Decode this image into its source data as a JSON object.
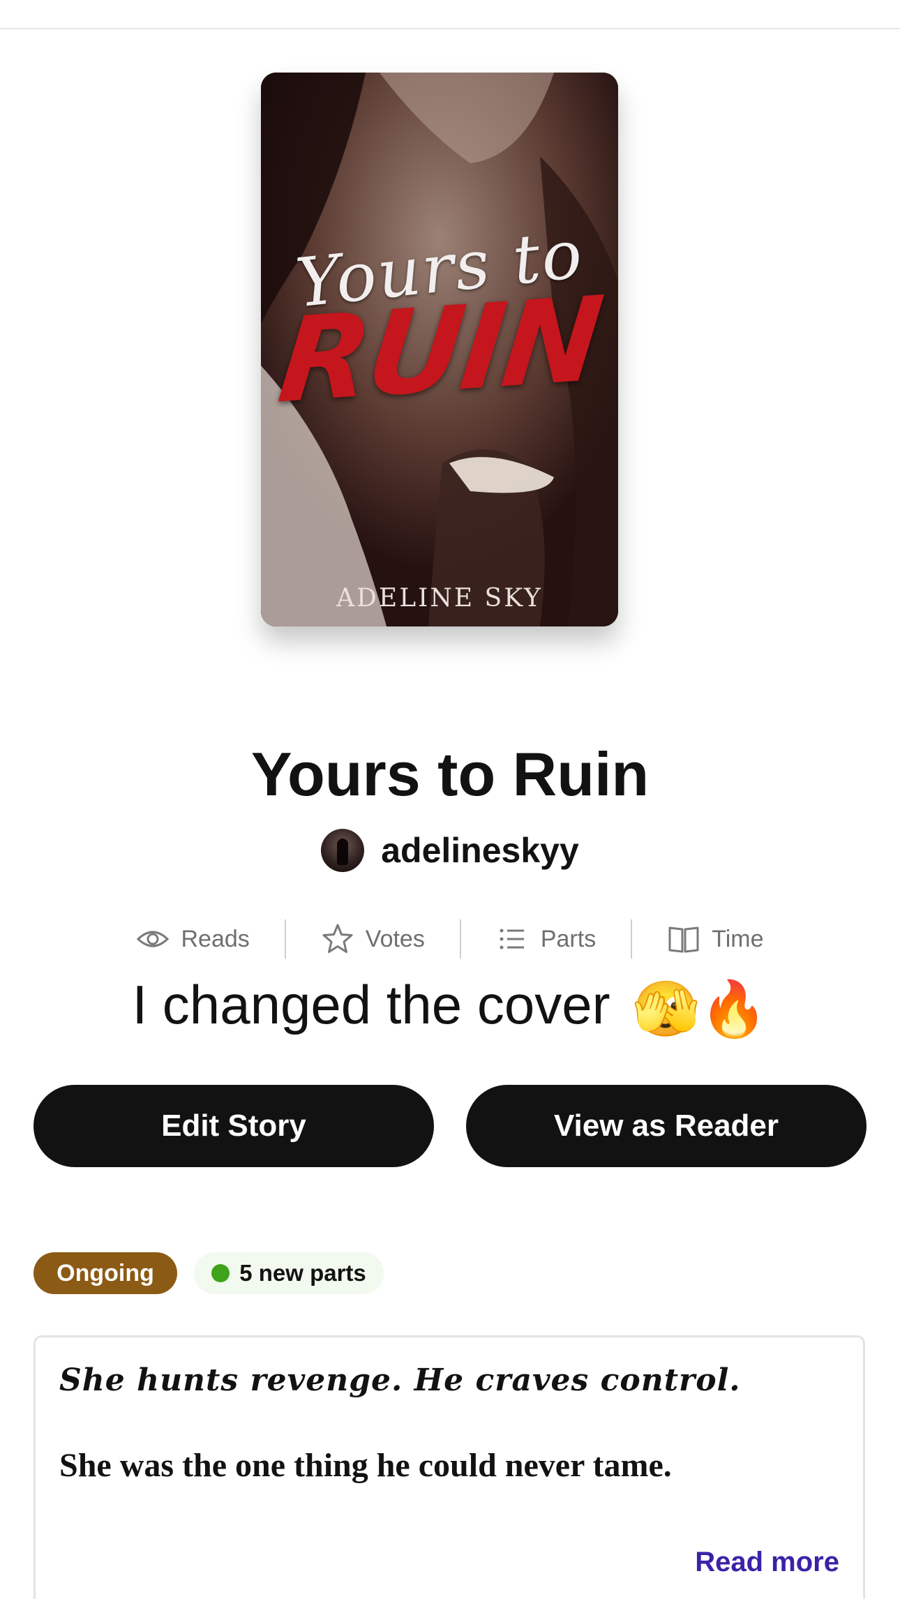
{
  "cover": {
    "script_text": "Yours to",
    "main_text": "RUIN",
    "author_text": "ADELINE  SKY"
  },
  "story": {
    "title": "Yours to Ruin",
    "author": "adelineskyy"
  },
  "stats": {
    "reads_label": "Reads",
    "votes_label": "Votes",
    "parts_label": "Parts",
    "time_label": "Time"
  },
  "cover_note": {
    "text": "I changed the cover",
    "emoji": "🫣🔥"
  },
  "actions": {
    "edit_label": "Edit Story",
    "view_label": "View as Reader"
  },
  "badges": {
    "status": "Ongoing",
    "new_parts": "5 new parts",
    "status_color": "#8b5a14",
    "new_dot_color": "#3ea31a"
  },
  "description": {
    "line1": "She hunts revenge. He craves control.",
    "line2": "She was the one thing he could never tame.",
    "read_more": "Read more"
  },
  "icons": {
    "reads": "eye-icon",
    "votes": "star-icon",
    "parts": "list-icon",
    "time": "book-icon"
  }
}
